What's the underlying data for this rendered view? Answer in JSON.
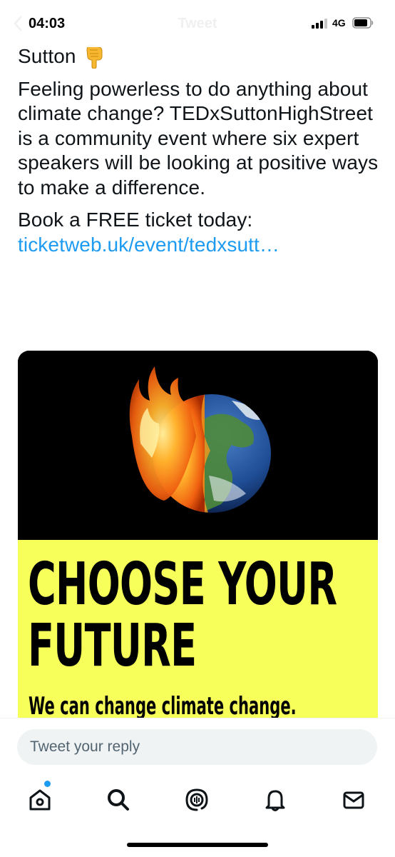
{
  "status_bar": {
    "time": "04:03",
    "network": "4G",
    "title": "Tweet"
  },
  "tweet": {
    "author_line": "Sutton",
    "author_emoji": "backhand-index-pointing-down",
    "body": "Feeling powerless to do anything about climate change? TEDxSuttonHighStreet is a community event where six expert speakers will be looking at positive ways to make a difference.",
    "cta": "Book a FREE ticket today:",
    "link": "ticketweb.uk/event/tedxsutt…"
  },
  "media": {
    "headline_line1": "CHOOSE YOUR",
    "headline_line2": "FUTURE",
    "tagline": "We can change climate change.",
    "image": "burning-earth",
    "colors": {
      "top": "#000000",
      "bottom": "#f7ff5a"
    }
  },
  "reply": {
    "placeholder": "Tweet your reply"
  },
  "tab_bar": {
    "items": [
      "home-icon",
      "search-icon",
      "spaces-icon",
      "notifications-icon",
      "messages-icon"
    ],
    "accent": "#1d9bf0"
  }
}
